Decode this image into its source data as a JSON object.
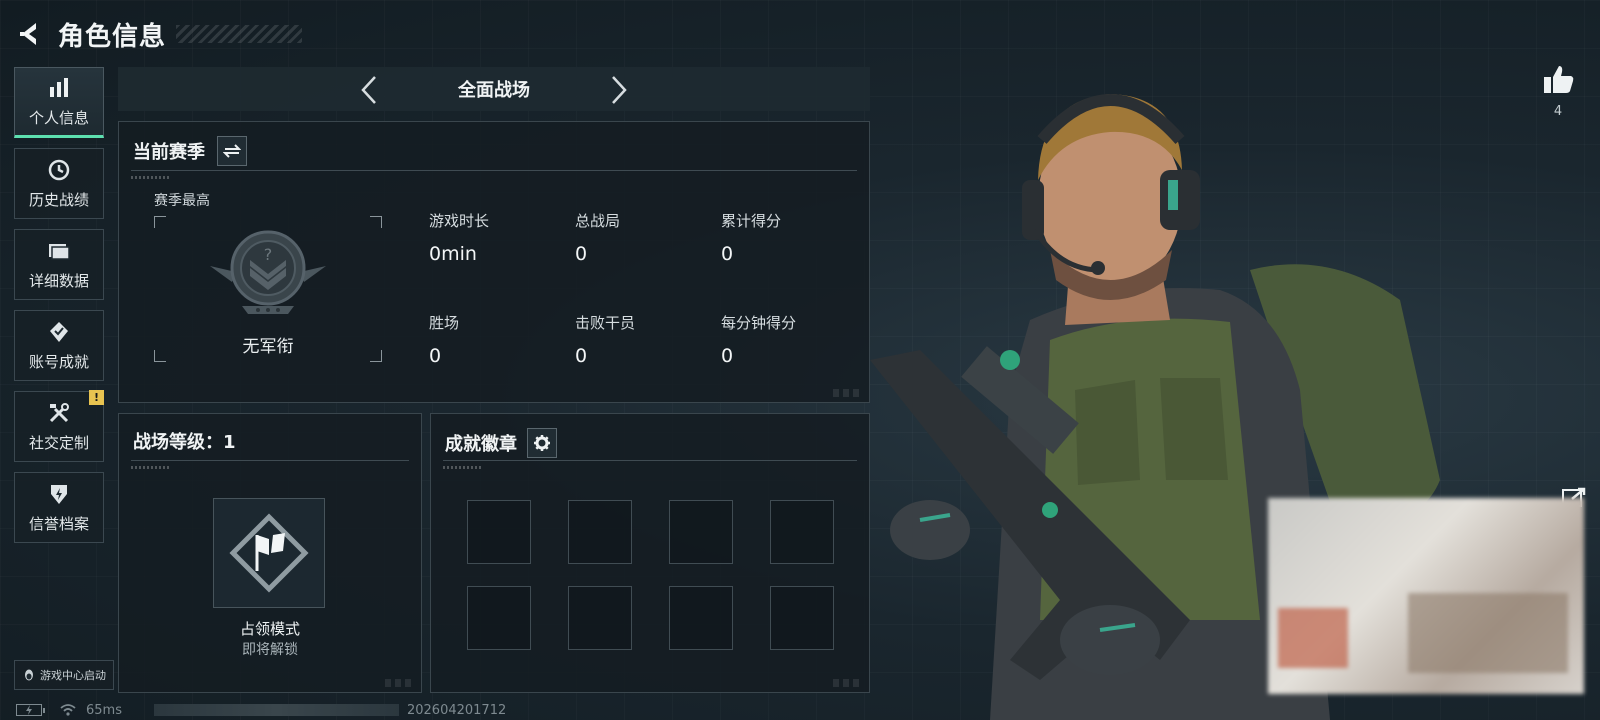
{
  "header": {
    "title": "角色信息"
  },
  "sidebar": {
    "items": [
      {
        "label": "个人信息",
        "icon": "bar-chart-icon",
        "active": true
      },
      {
        "label": "历史战绩",
        "icon": "clock-history-icon"
      },
      {
        "label": "详细数据",
        "icon": "folder-icon"
      },
      {
        "label": "账号成就",
        "icon": "achievement-icon"
      },
      {
        "label": "社交定制",
        "icon": "tools-icon",
        "badge": "!"
      },
      {
        "label": "信誉档案",
        "icon": "shield-icon"
      }
    ],
    "launch_label": "游戏中心启动"
  },
  "mode_switcher": {
    "title": "全面战场"
  },
  "season_panel": {
    "title": "当前赛季",
    "season_high_label": "赛季最高",
    "rank_name": "无军衔",
    "stats": [
      {
        "label": "游戏时长",
        "value": "0min"
      },
      {
        "label": "总战局",
        "value": "0"
      },
      {
        "label": "累计得分",
        "value": "0"
      },
      {
        "label": "胜场",
        "value": "0"
      },
      {
        "label": "击败干员",
        "value": "0"
      },
      {
        "label": "每分钟得分",
        "value": "0"
      }
    ]
  },
  "level_panel": {
    "title": "战场等级：1",
    "mode_name": "占领模式",
    "mode_status": "即将解锁"
  },
  "badge_panel": {
    "title": "成就徽章",
    "slots": 8
  },
  "like": {
    "count": "4"
  },
  "status_bar": {
    "ping": "65ms",
    "build": "202604201712"
  },
  "colors": {
    "accent": "#5de0b0",
    "badge_warning": "#e8c350",
    "panel_border": "#3a464d",
    "background": "#16222a"
  }
}
